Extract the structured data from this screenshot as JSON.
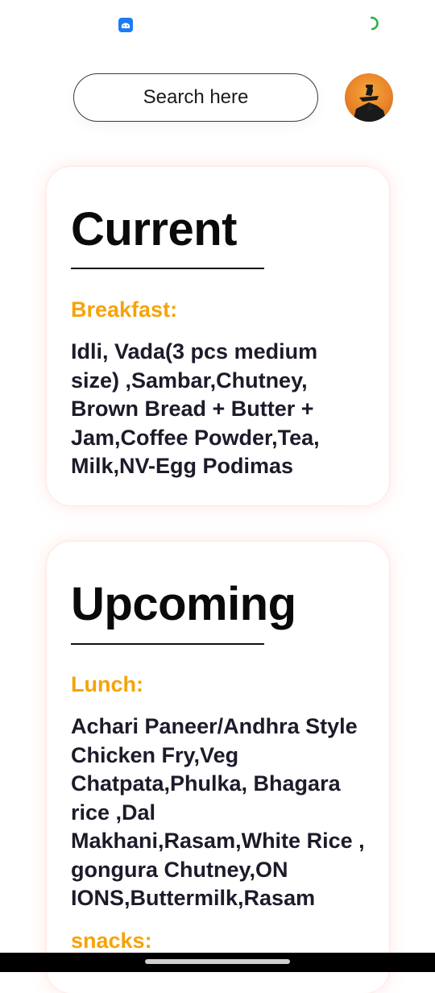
{
  "search": {
    "placeholder": "Search here"
  },
  "current": {
    "title": "Current",
    "meal_label": "Breakfast:",
    "meal_items": "Idli, Vada(3 pcs medium size) ,Sambar,Chutney, Brown Bread + Butter + Jam,Coffee Powder,Tea, Milk,NV-Egg Podimas"
  },
  "upcoming": {
    "title": "Upcoming",
    "meal_label": "Lunch:",
    "meal_items": "Achari Paneer/Andhra Style Chicken Fry,Veg Chatpata,Phulka, Bhagara rice ,Dal Makhani,Rasam,White Rice , gongura Chutney,ON IONS,Buttermilk,Rasam",
    "next_label": "snacks:"
  },
  "colors": {
    "accent": "#f5a30a",
    "status_app_icon": "#1e7cf2",
    "spinner": "#2fb34a"
  },
  "icons": {
    "status_app": "app-notification-icon",
    "status_spinner": "loading-spinner-icon",
    "avatar": "profile-avatar"
  }
}
